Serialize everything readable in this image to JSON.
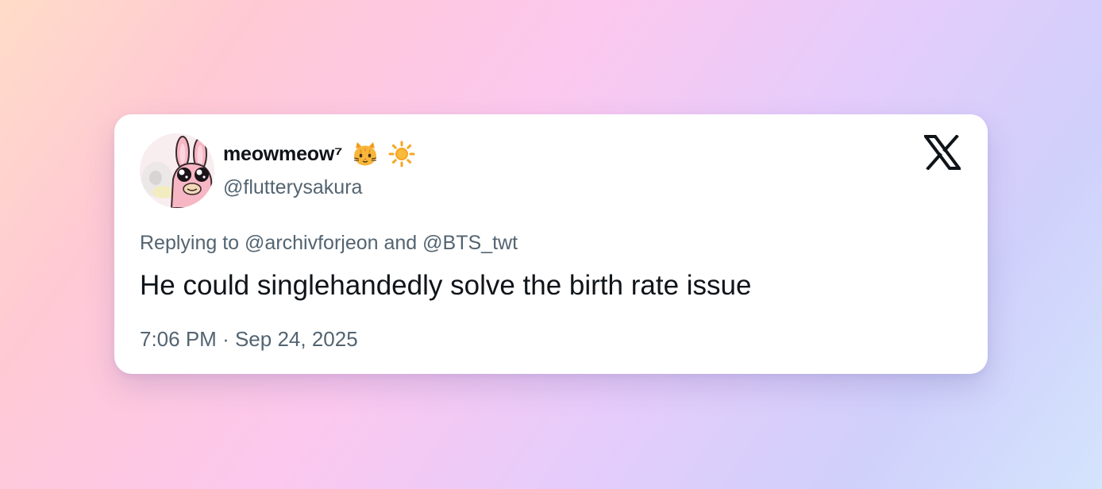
{
  "tweet": {
    "display_name": "meowmeow⁷",
    "name_emojis": [
      "cat-face-emoji",
      "sun-emoji"
    ],
    "handle": "@flutterysakura",
    "reply_prefix": "Replying to",
    "reply_user_1": "@archivforjeon",
    "reply_joiner": "and",
    "reply_user_2": "@BTS_twt",
    "text": "He could singlehandedly solve the birth rate issue",
    "time": "7:06 PM",
    "separator": "·",
    "date": "Sep 24, 2025"
  },
  "icons": {
    "avatar": "pink-bunny-avatar",
    "brand": "x-logo-icon"
  },
  "colors": {
    "primary_text": "#0f1419",
    "secondary_text": "#536471",
    "card_background": "#ffffff",
    "cat_emoji": "#f5a623",
    "sun_emoji": "#f6a623"
  }
}
